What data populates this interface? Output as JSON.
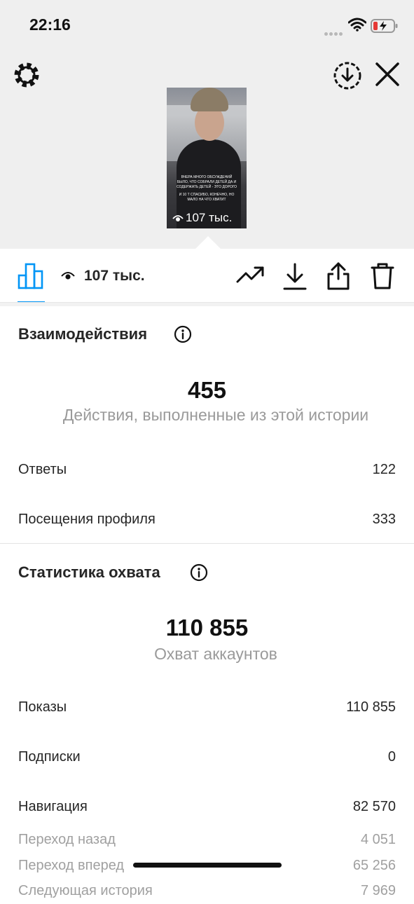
{
  "status_bar": {
    "time": "22:16"
  },
  "story": {
    "caption_line1": "ВЧЕРА МНОГО ОБСУЖДЕНИЙ",
    "caption_line2": "БЫЛО, ЧТО СОБРАЛИ ДЕТЕЙ ДА И",
    "caption_line3": "СОДЕРЖАТЬ ДЕТЕЙ - ЭТО ДОРОГО",
    "caption_line4": "И 10 Т СПАСИБО, КОНЕЧНО, НО",
    "caption_line5": "МАЛО НА ЧТО ХВАТИТ",
    "views_label": "107 тыс."
  },
  "toolbar": {
    "views_count": "107 тыс."
  },
  "interactions": {
    "title": "Взаимодействия",
    "total": "455",
    "caption": "Действия, выполненные из этой истории",
    "rows": [
      {
        "label": "Ответы",
        "value": "122"
      },
      {
        "label": "Посещения профиля",
        "value": "333"
      }
    ]
  },
  "reach": {
    "title": "Статистика охвата",
    "total": "110 855",
    "caption": "Охват аккаунтов",
    "rows": [
      {
        "label": "Показы",
        "value": "110 855"
      },
      {
        "label": "Подписки",
        "value": "0"
      },
      {
        "label": "Навигация",
        "value": "82 570"
      },
      {
        "label": "Переход назад",
        "value": "4 051"
      },
      {
        "label": "Переход вперед",
        "value": "65 256"
      },
      {
        "label": "Следующая история",
        "value": "7 969"
      }
    ]
  },
  "colors": {
    "accent": "#0095f6",
    "text": "#262626",
    "muted": "#9a9a9a",
    "top_background": "#efefef"
  }
}
